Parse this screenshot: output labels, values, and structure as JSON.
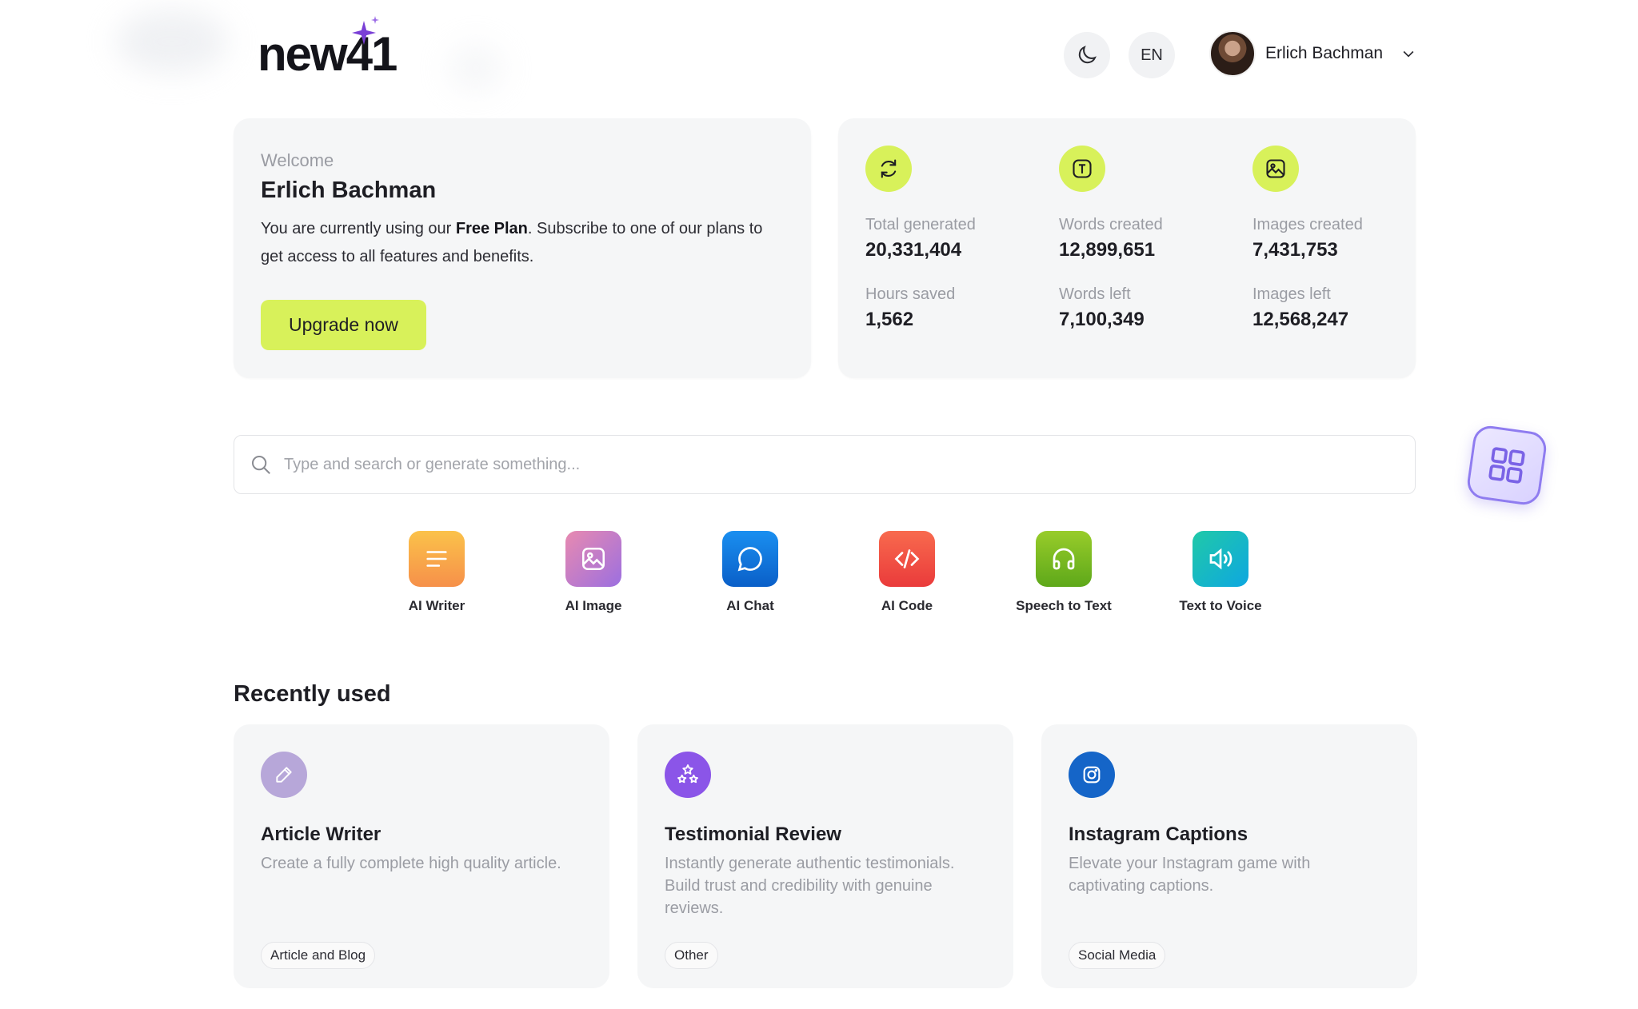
{
  "header": {
    "logo_text": "new41",
    "theme_icon": "moon-icon",
    "language": "EN",
    "user_name": "Erlich Bachman",
    "user_menu_icon": "chevron-down-icon"
  },
  "welcome": {
    "label": "Welcome",
    "name": "Erlich Bachman",
    "desc_prefix": "You are currently using our ",
    "plan": "Free Plan",
    "desc_suffix": ". Subscribe to one of our plans to get access to all features and benefits.",
    "upgrade_label": "Upgrade now"
  },
  "stats": {
    "icons": [
      "refresh-icon",
      "text-icon",
      "image-icon"
    ],
    "items": [
      {
        "label": "Total generated",
        "value": "20,331,404"
      },
      {
        "label": "Words created",
        "value": "12,899,651"
      },
      {
        "label": "Images created",
        "value": "7,431,753"
      },
      {
        "label": "Hours saved",
        "value": "1,562"
      },
      {
        "label": "Words left",
        "value": "7,100,349"
      },
      {
        "label": "Images left",
        "value": "12,568,247"
      }
    ]
  },
  "search": {
    "placeholder": "Type and search or generate something...",
    "value": ""
  },
  "tools": [
    {
      "label": "AI Writer",
      "icon": "lines-icon",
      "color": "#f8a83a"
    },
    {
      "label": "AI Image",
      "icon": "image-icon",
      "color": "#b07ad6"
    },
    {
      "label": "AI Chat",
      "icon": "chat-bubble-icon",
      "color": "#1a7fe0"
    },
    {
      "label": "AI Code",
      "icon": "code-icon",
      "color": "#f0523d"
    },
    {
      "label": "Speech to Text",
      "icon": "headphones-icon",
      "color": "#7fbf1e"
    },
    {
      "label": "Text to Voice",
      "icon": "speaker-icon",
      "color": "#17b8c4"
    }
  ],
  "recent": {
    "title": "Recently used",
    "items": [
      {
        "title": "Article Writer",
        "desc": "Create a fully complete high quality article.",
        "tag": "Article and Blog",
        "icon": "pencil-icon",
        "color": "#b7a7d9"
      },
      {
        "title": "Testimonial Review",
        "desc": "Instantly generate authentic testimonials. Build trust and credibility with genuine reviews.",
        "tag": "Other",
        "icon": "stars-icon",
        "color": "#8b55e8"
      },
      {
        "title": "Instagram Captions",
        "desc": "Elevate your Instagram game with captivating captions.",
        "tag": "Social Media",
        "icon": "instagram-icon",
        "color": "#1565c8"
      }
    ]
  },
  "floating_button": {
    "icon": "grid-icon"
  }
}
